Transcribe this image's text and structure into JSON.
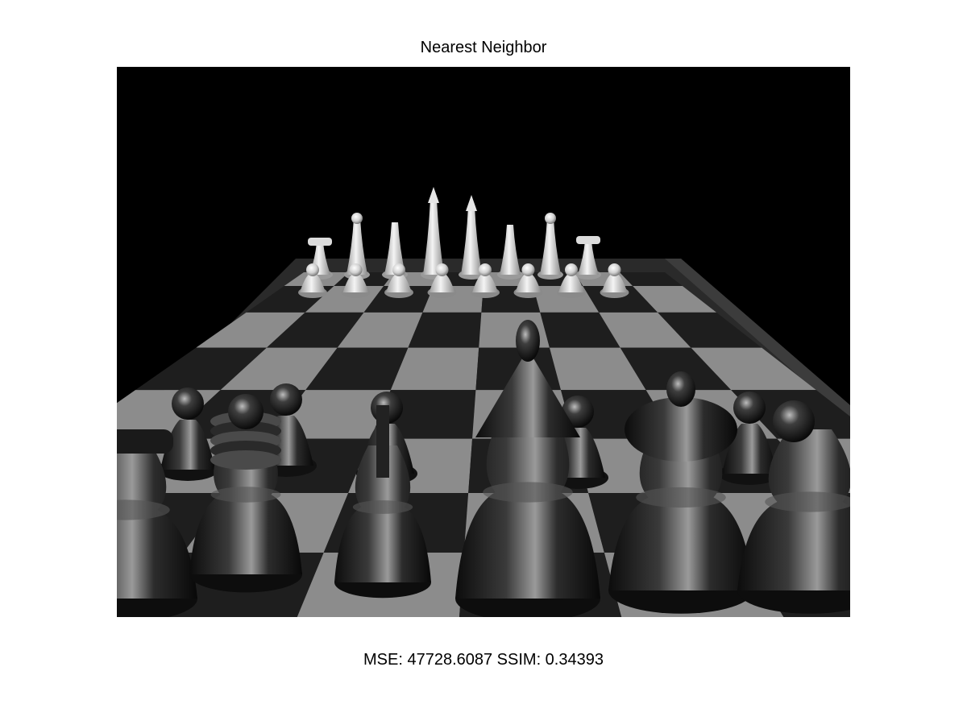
{
  "figure": {
    "title": "Nearest Neighbor",
    "metrics_text": "MSE: 47728.6087 SSIM: 0.34393"
  },
  "image": {
    "subject": "chess-board-render",
    "palette": {
      "background": "#000000",
      "light_square": "#8c8c8c",
      "dark_square": "#1e1e1e",
      "board_rim": "#2a2a2a",
      "white_piece": "#e8e8e8",
      "black_piece": "#1a1a1a"
    }
  }
}
